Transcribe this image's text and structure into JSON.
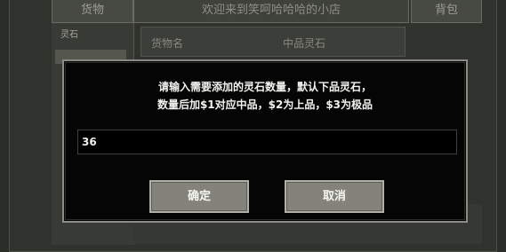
{
  "shop": {
    "goods_tab": "货物",
    "title": "欢迎来到笑呵哈哈哈的小店",
    "bag_tab": "背包",
    "side_item": "灵石",
    "item_name_label": "货物名",
    "item_name_value": "中品灵石"
  },
  "dialog": {
    "prompt_line1": "请输入需要添加的灵石数量，默认下品灵石，",
    "prompt_line2": "数量后加$1对应中品，$2为上品，$3为极品",
    "input_value": "36",
    "confirm_label": "确定",
    "cancel_label": "取消"
  }
}
